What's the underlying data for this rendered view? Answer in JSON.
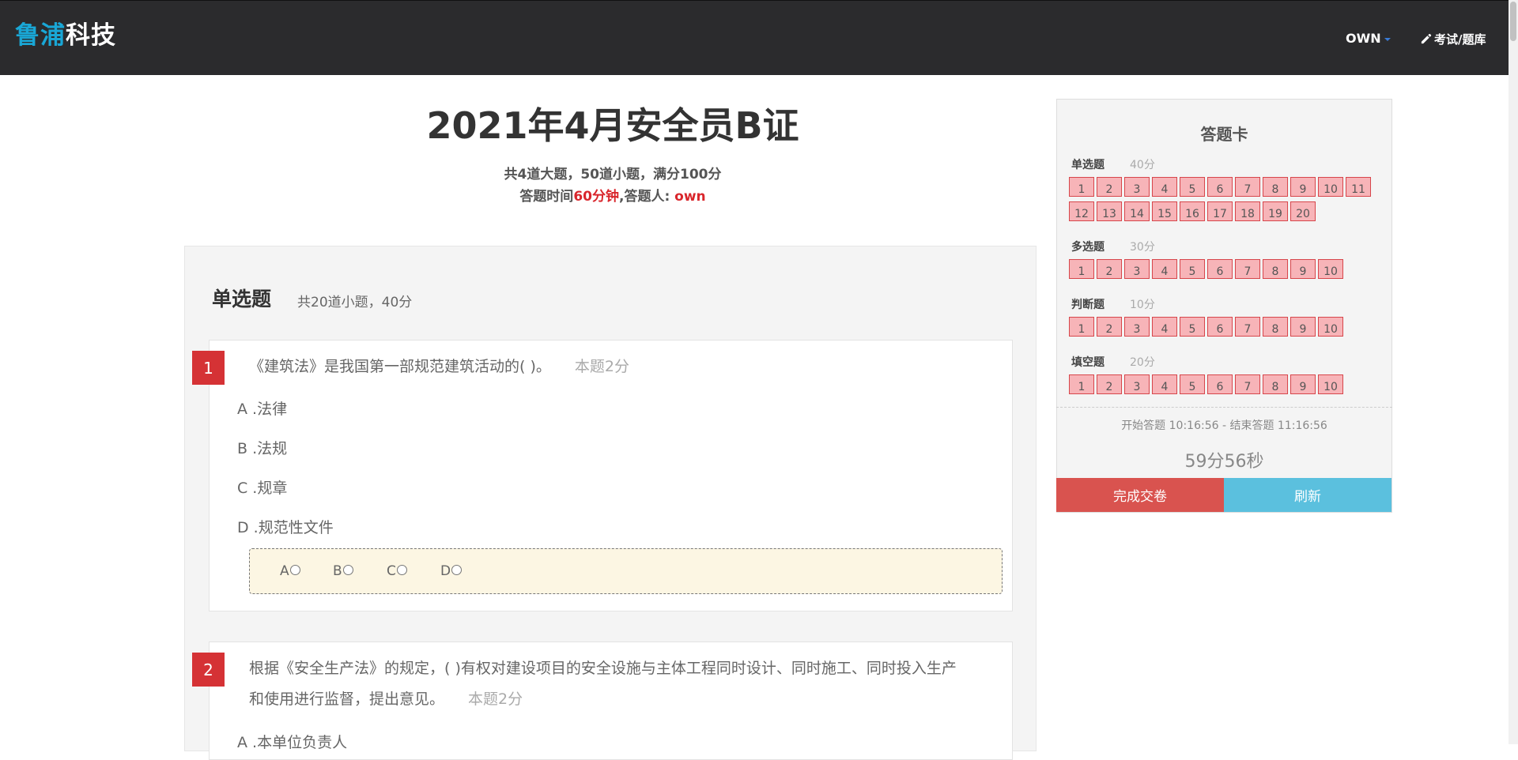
{
  "nav": {
    "brand_part1": "鲁浦",
    "brand_part2": "科技",
    "user_label": "OWN",
    "exam_link": "考试/题库"
  },
  "header": {
    "title": "2021年4月安全员B证",
    "summary": "共4道大题，50道小题，满分100分",
    "time_prefix": "答题时间",
    "time_value": "60分钟",
    "answerer_prefix": ",答题人: ",
    "answerer": "own"
  },
  "section": {
    "title": "单选题",
    "subtitle": "共20道小题，40分"
  },
  "questions": [
    {
      "number": "1",
      "line1": "《建筑法》是我国第一部规范建筑活动的( )。",
      "score": "本题2分",
      "options": [
        "A .法律",
        "B .法规",
        "C .规章",
        "D .规范性文件"
      ],
      "choices": [
        "A",
        "B",
        "C",
        "D"
      ]
    },
    {
      "number": "2",
      "line1": "根据《安全生产法》的规定，( )有权对建设项目的安全设施与主体工程同时设计、同时施工、同时投入生产",
      "line2": "和使用进行监督，提出意见。",
      "score": "本题2分",
      "options": [
        "A .本单位负责人"
      ]
    }
  ],
  "answer_card": {
    "title": "答题卡",
    "groups": [
      {
        "label": "单选题",
        "score": "40分",
        "numbers": [
          "1",
          "2",
          "3",
          "4",
          "5",
          "6",
          "7",
          "8",
          "9",
          "10",
          "11",
          "12",
          "13",
          "14",
          "15",
          "16",
          "17",
          "18",
          "19",
          "20"
        ]
      },
      {
        "label": "多选题",
        "score": "30分",
        "numbers": [
          "1",
          "2",
          "3",
          "4",
          "5",
          "6",
          "7",
          "8",
          "9",
          "10"
        ]
      },
      {
        "label": "判断题",
        "score": "10分",
        "numbers": [
          "1",
          "2",
          "3",
          "4",
          "5",
          "6",
          "7",
          "8",
          "9",
          "10"
        ]
      },
      {
        "label": "填空题",
        "score": "20分",
        "numbers": [
          "1",
          "2",
          "3",
          "4",
          "5",
          "6",
          "7",
          "8",
          "9",
          "10"
        ]
      }
    ],
    "time_range": "开始答题 10:16:56 - 结束答题 11:16:56",
    "countdown": "59分56秒",
    "submit_label": "完成交卷",
    "refresh_label": "刷新"
  },
  "colors": {
    "navbar": "#2b2b2d",
    "brand_accent": "#19a7d6",
    "question_badge": "#d53235",
    "cell_fill": "#f7b4b8",
    "submit": "#d9534f",
    "refresh": "#5bc0de"
  }
}
